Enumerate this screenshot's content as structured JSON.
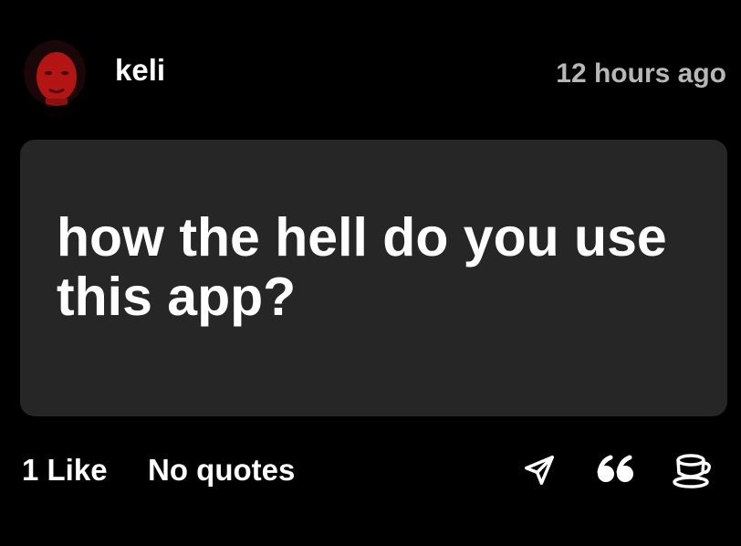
{
  "post": {
    "username": "keli",
    "timestamp": "12 hours ago",
    "text": "how the hell do you use this app?",
    "likes_label": "1 Like",
    "quotes_label": "No quotes"
  },
  "icons": {
    "send": "send-icon",
    "quote": "quote-icon",
    "cup": "coffee-cup-icon"
  },
  "colors": {
    "background": "#000000",
    "card": "#262626",
    "text": "#ffffff",
    "muted": "#b7b7b7",
    "avatar_accent": "#c01818"
  }
}
